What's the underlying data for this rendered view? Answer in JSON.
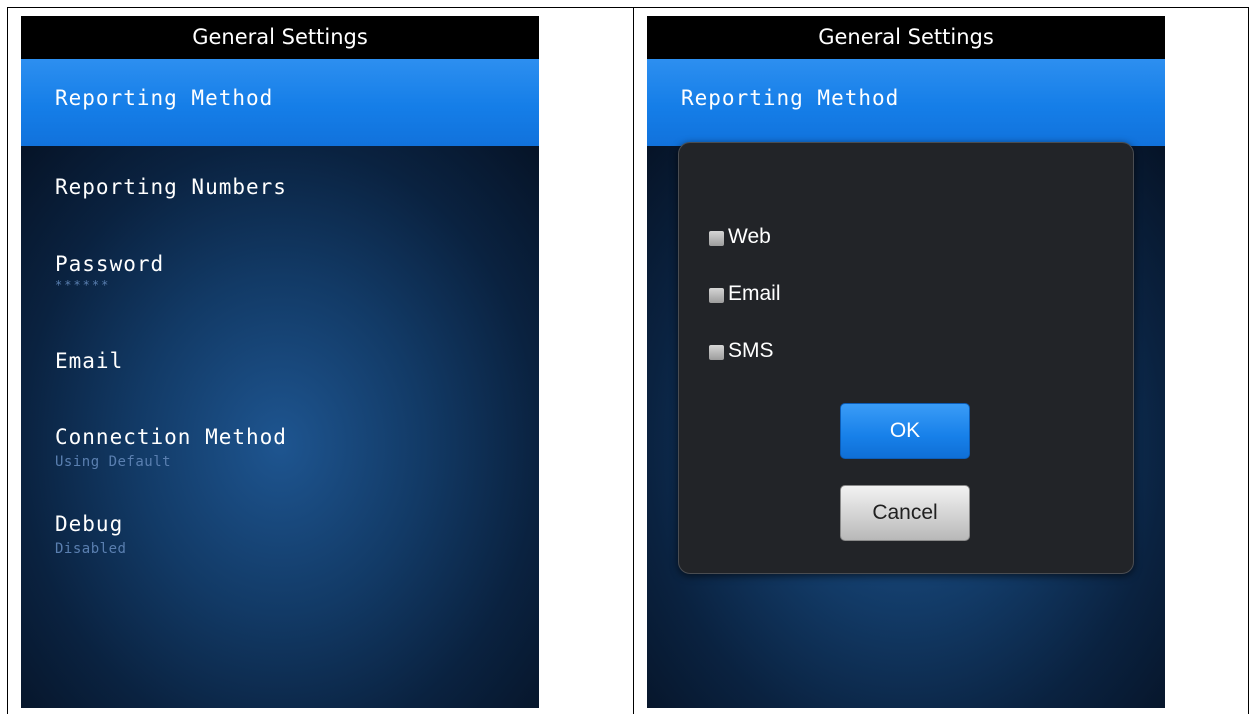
{
  "left_screen": {
    "title": "General Settings",
    "selected_item": "Reporting Method",
    "items": [
      {
        "label": "Reporting Numbers",
        "sub": ""
      },
      {
        "label": "Password",
        "sub": "******"
      },
      {
        "label": "Email",
        "sub": ""
      },
      {
        "label": "Connection Method",
        "sub": "Using Default"
      },
      {
        "label": "Debug",
        "sub": "Disabled"
      }
    ]
  },
  "right_screen": {
    "title": "General Settings",
    "selected_item": "Reporting Method",
    "dialog": {
      "options": [
        {
          "label": "Web",
          "checked": false
        },
        {
          "label": "Email",
          "checked": false
        },
        {
          "label": "SMS",
          "checked": false
        }
      ],
      "ok_label": "OK",
      "cancel_label": "Cancel"
    }
  },
  "colors": {
    "accent": "#157ee8",
    "title_bar": "#000000",
    "dialog_bg": "#222428",
    "sub_text": "#5a7fb0"
  }
}
